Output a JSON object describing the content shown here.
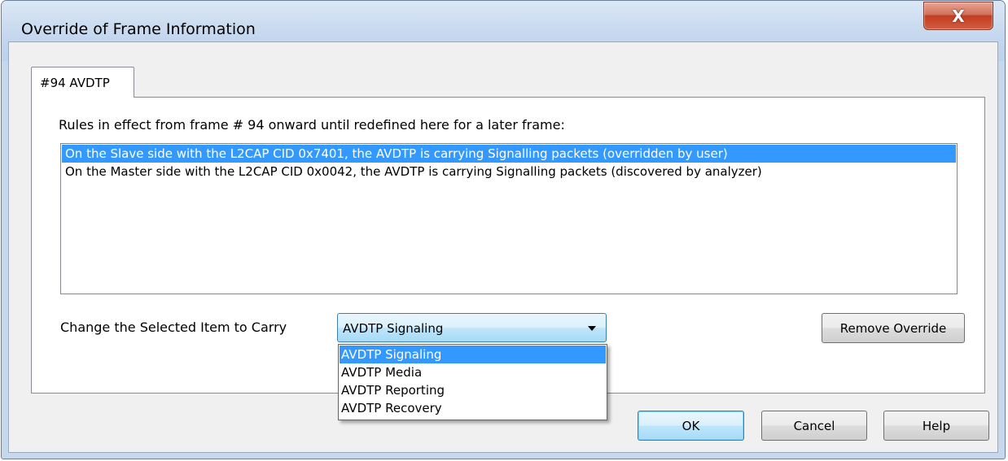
{
  "window": {
    "title": "Override of Frame Information",
    "close_glyph": "X"
  },
  "tab": {
    "label": "#94 AVDTP"
  },
  "rules": {
    "label": "Rules in effect from frame # 94 onward until redefined here for a later frame:",
    "items": [
      {
        "text": "On the Slave side with the L2CAP CID 0x7401, the AVDTP is carrying Signalling packets (overridden by user)",
        "selected": true
      },
      {
        "text": "On the Master side with the L2CAP CID 0x0042, the AVDTP is carrying Signalling packets (discovered by analyzer)",
        "selected": false
      }
    ]
  },
  "carry": {
    "label": "Change the Selected Item to Carry",
    "selected_value": "AVDTP Signaling",
    "options": [
      "AVDTP Signaling",
      "AVDTP Media",
      "AVDTP Reporting",
      "AVDTP Recovery"
    ],
    "highlighted_option": "AVDTP Signaling"
  },
  "buttons": {
    "remove_override": "Remove Override",
    "ok": "OK",
    "cancel": "Cancel",
    "help": "Help"
  },
  "colors": {
    "selection": "#3399ff",
    "close_button": "#c23d22"
  }
}
